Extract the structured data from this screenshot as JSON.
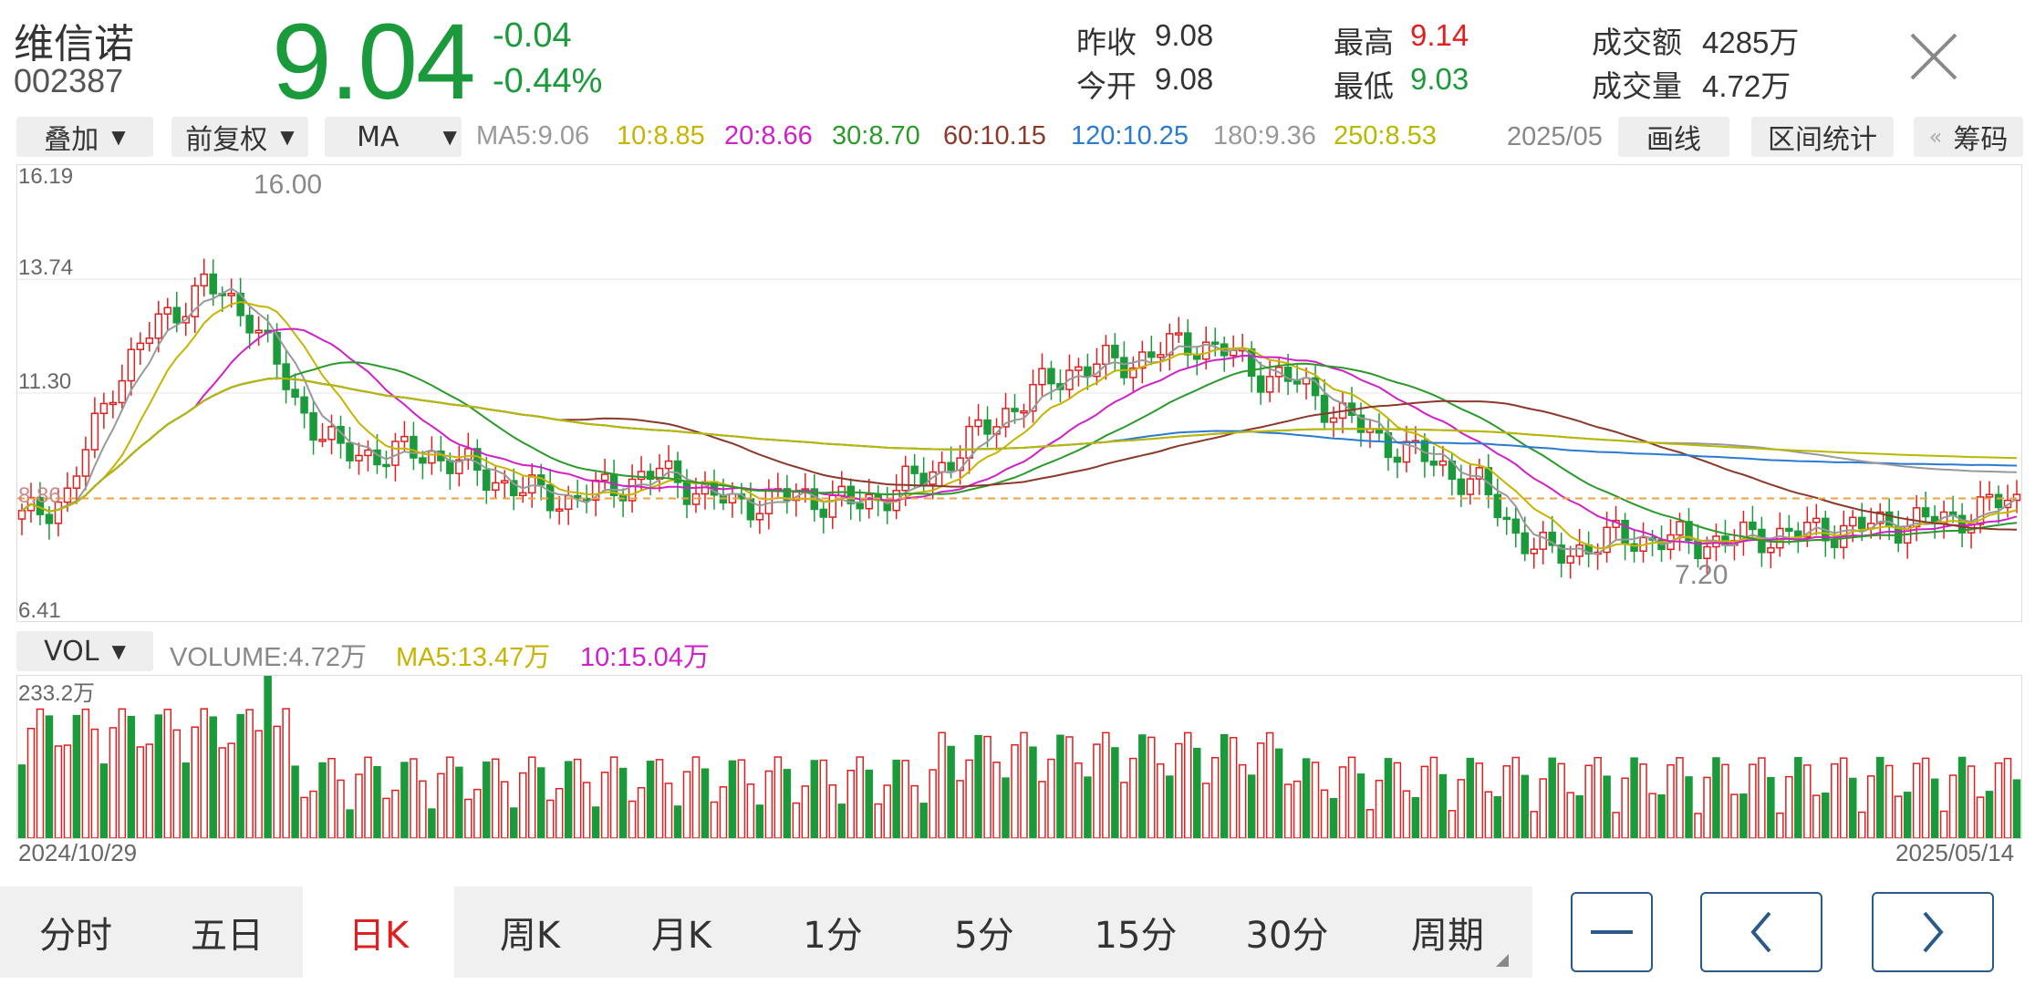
{
  "header": {
    "name": "维信诺",
    "code": "002387",
    "price": "9.04",
    "change": "-0.04",
    "change_pct": "-0.44%",
    "quotes": [
      {
        "label": "昨收",
        "value": "9.08",
        "color": "#333333"
      },
      {
        "label": "今开",
        "value": "9.08",
        "color": "#333333"
      },
      {
        "label": "最高",
        "value": "9.14",
        "color": "#e02020"
      },
      {
        "label": "最低",
        "value": "9.03",
        "color": "#1a9a3a"
      },
      {
        "label": "成交额",
        "value": "4285万",
        "color": "#333333"
      },
      {
        "label": "成交量",
        "value": "4.72万",
        "color": "#333333"
      }
    ]
  },
  "toolbar": {
    "overlay": "叠加",
    "adjust": "前复权",
    "indicator": "MA",
    "ma_items": [
      {
        "label": "MA5:9.06",
        "color": "#999999"
      },
      {
        "label": "10:8.85",
        "color": "#c8b400"
      },
      {
        "label": "20:8.66",
        "color": "#d020c8"
      },
      {
        "label": "30:8.70",
        "color": "#2a9a2a"
      },
      {
        "label": "60:10.15",
        "color": "#8b3a2a"
      },
      {
        "label": "120:10.25",
        "color": "#2a7ad0"
      },
      {
        "label": "180:9.36",
        "color": "#999999"
      },
      {
        "label": "250:8.53",
        "color": "#b8b800"
      }
    ],
    "date_truncated": "2025/05",
    "draw_line": "画线",
    "range_stats": "区间统计",
    "chips": "筹码",
    "chips_prefix": "«"
  },
  "chart": {
    "y_top": "16.19",
    "y_mid": "13.74",
    "y_low": "11.30",
    "y_bottom": "6.41",
    "high_label": "16.00",
    "low_label": "7.20",
    "left_overlay_text": "8.86"
  },
  "volume": {
    "indicator": "VOL",
    "volume": "VOLUME:4.72万",
    "ma5": "MA5:13.47万",
    "ma10": "10:15.04万",
    "max": "233.2万",
    "start_date": "2024/10/29",
    "end_date": "2025/05/14"
  },
  "tabs": [
    "分时",
    "五日",
    "日K",
    "周K",
    "月K",
    "1分",
    "5分",
    "15分",
    "30分",
    "周期"
  ],
  "active_tab": "日K",
  "colors": {
    "up": "#e02020",
    "down": "#1a9a3a",
    "nav": "#2a5a8a"
  },
  "icons": [
    "close-icon",
    "minus-icon",
    "chevron-left-icon",
    "chevron-right-icon"
  ]
}
